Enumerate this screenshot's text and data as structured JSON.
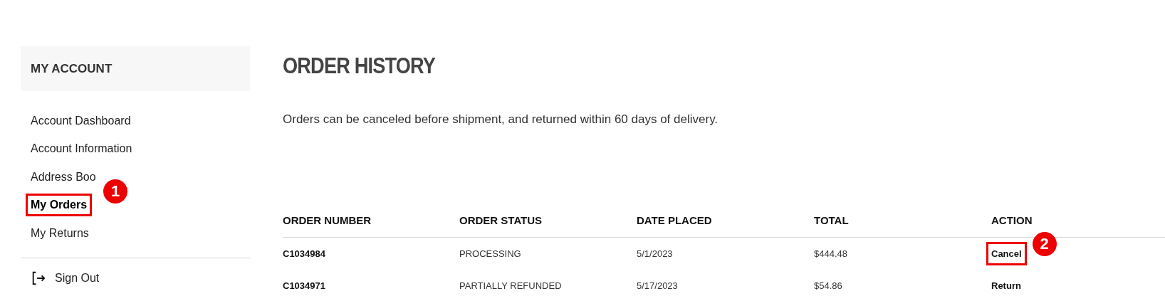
{
  "sidebar": {
    "title": "MY ACCOUNT",
    "items": [
      {
        "label": "Account Dashboard",
        "selected": false,
        "highlighted": false
      },
      {
        "label": "Account Information",
        "selected": false,
        "highlighted": false
      },
      {
        "label": "Address Boo",
        "selected": false,
        "highlighted": false
      },
      {
        "label": "My Orders",
        "selected": true,
        "highlighted": true,
        "badge": "1"
      },
      {
        "label": "My Returns",
        "selected": false,
        "highlighted": false
      }
    ],
    "sign_out": "Sign Out"
  },
  "main": {
    "title": "ORDER HISTORY",
    "note": "Orders can be canceled before shipment, and returned within 60 days of delivery.",
    "table": {
      "columns": [
        "ORDER NUMBER",
        "ORDER STATUS",
        "DATE PLACED",
        "TOTAL",
        "ACTION"
      ],
      "rows": [
        {
          "order_number": "C1034984",
          "status": "PROCESSING",
          "date": "5/1/2023",
          "total": "$444.48",
          "action": "Cancel",
          "highlighted": true,
          "badge": "2"
        },
        {
          "order_number": "C1034971",
          "status": "PARTIALLY REFUNDED",
          "date": "5/17/2023",
          "total": "$54.86",
          "action": "Return",
          "highlighted": false
        }
      ]
    }
  }
}
